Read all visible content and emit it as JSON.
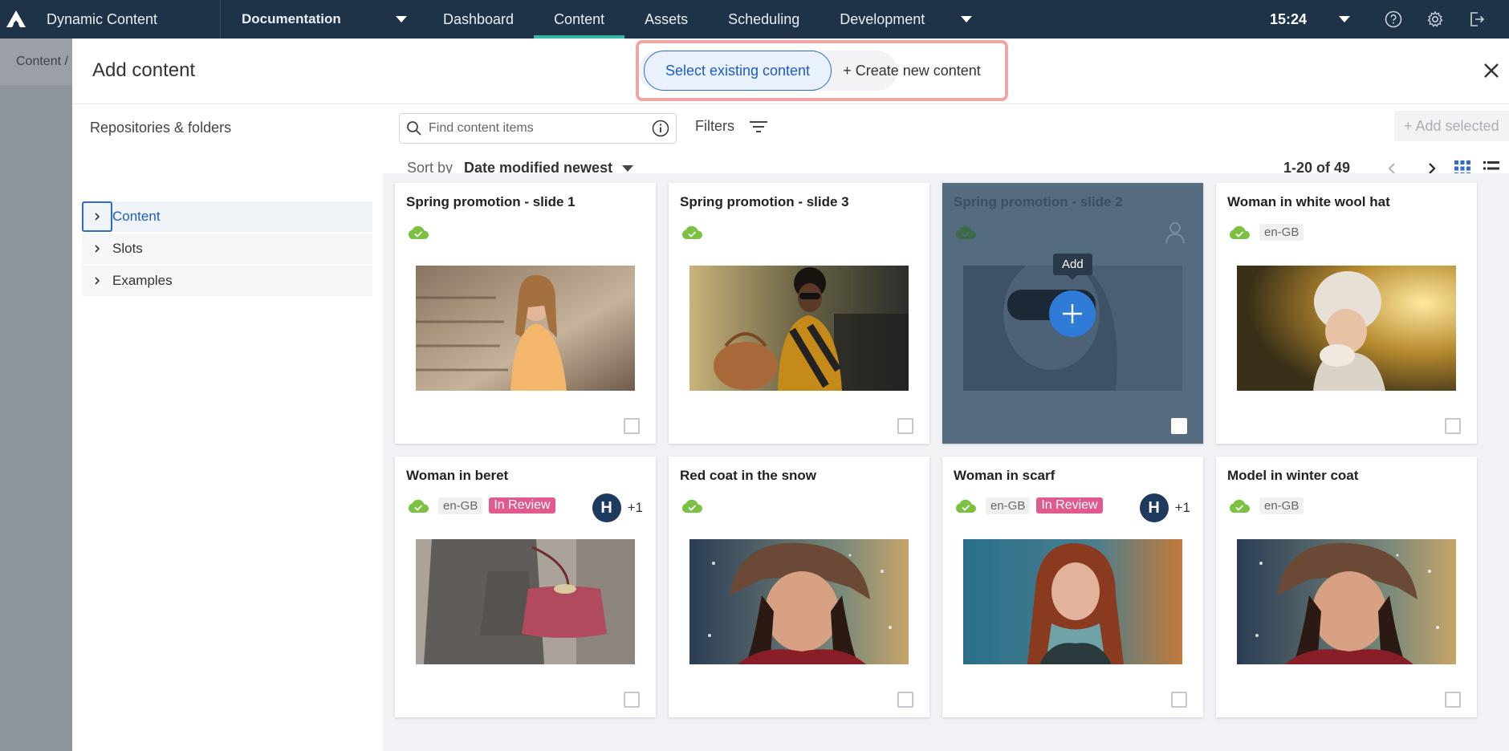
{
  "app": {
    "name": "Dynamic Content",
    "hub": "Documentation"
  },
  "nav": {
    "tabs": [
      "Dashboard",
      "Content",
      "Assets",
      "Scheduling",
      "Development"
    ],
    "active": "Content",
    "time": "15:24"
  },
  "background": {
    "breadcrumb": "Content /"
  },
  "modal": {
    "title": "Add content",
    "mode": {
      "select_label": "Select existing content",
      "create_label": "+ Create new content"
    }
  },
  "sidebar": {
    "title": "Repositories & folders",
    "items": [
      {
        "label": "Content"
      },
      {
        "label": "Slots"
      },
      {
        "label": "Examples"
      }
    ]
  },
  "toolbar": {
    "search_placeholder": "Find content items",
    "filters_label": "Filters",
    "add_selected_label": "+ Add selected",
    "sort_label": "Sort by",
    "sort_value": "Date modified newest",
    "pagination": "1-20 of 49"
  },
  "hover": {
    "tooltip": "Add"
  },
  "cards": [
    {
      "title": "Spring promotion - slide 1",
      "locale": "",
      "status": "",
      "assignee": ""
    },
    {
      "title": "Spring promotion - slide 3",
      "locale": "",
      "status": "",
      "assignee": ""
    },
    {
      "title": "Spring promotion - slide 2",
      "locale": "",
      "status": "",
      "assignee": ""
    },
    {
      "title": "Woman in white wool hat",
      "locale": "en-GB",
      "status": "",
      "assignee": ""
    },
    {
      "title": "Woman in beret",
      "locale": "en-GB",
      "status": "In Review",
      "assignee": "H",
      "assignee_more": "+1"
    },
    {
      "title": "Red coat in the snow",
      "locale": "",
      "status": "",
      "assignee": ""
    },
    {
      "title": "Woman in scarf",
      "locale": "en-GB",
      "status": "In Review",
      "assignee": "H",
      "assignee_more": "+1"
    },
    {
      "title": "Model in winter coat",
      "locale": "en-GB",
      "status": "",
      "assignee": ""
    }
  ],
  "colors": {
    "nav_bg": "#1e3347",
    "accent": "#2d6bd3",
    "published": "#7cc242",
    "review": "#e05a8f"
  }
}
